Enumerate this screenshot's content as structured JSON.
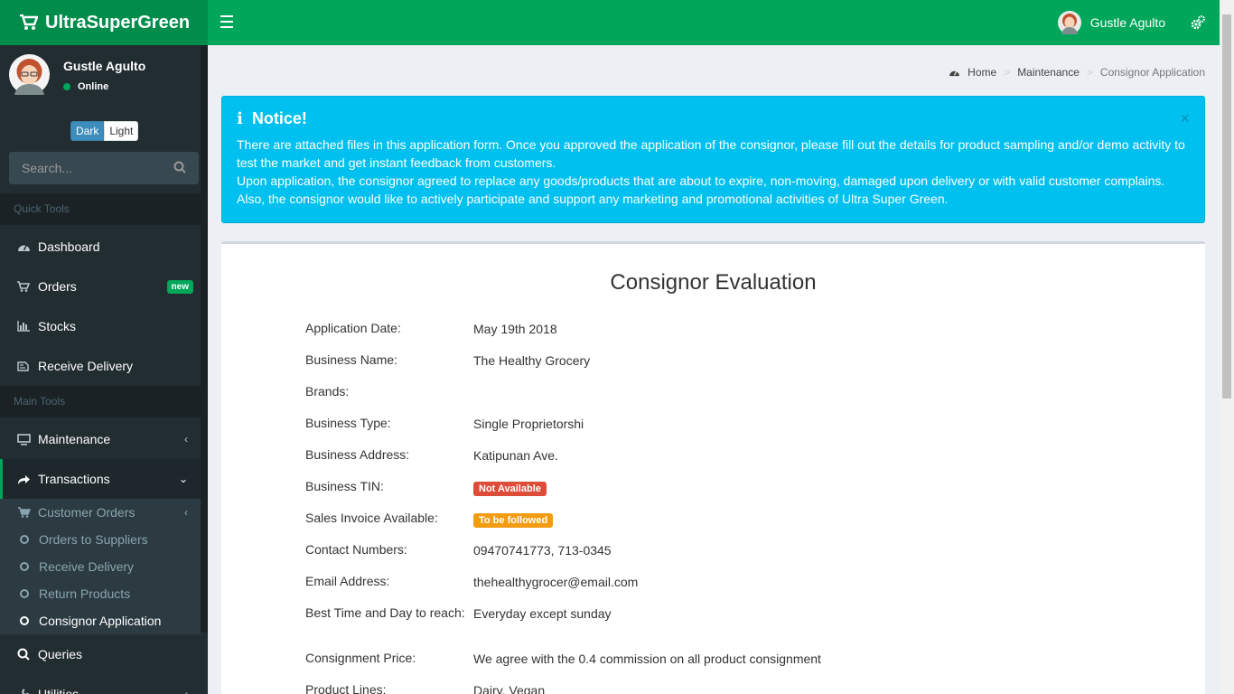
{
  "app": {
    "name": "UltraSuperGreen"
  },
  "header": {
    "user_name": "Gustle Agulto"
  },
  "sidebar": {
    "user": {
      "name": "Gustle Agulto",
      "status": "Online"
    },
    "theme": {
      "dark": "Dark",
      "light": "Light"
    },
    "search_placeholder": "Search...",
    "quick_tools_label": "Quick Tools",
    "main_tools_label": "Main Tools",
    "items": {
      "dashboard": "Dashboard",
      "orders": "Orders",
      "orders_badge": "new",
      "stocks": "Stocks",
      "receive_delivery": "Receive Delivery",
      "maintenance": "Maintenance",
      "transactions": "Transactions",
      "queries": "Queries",
      "utilities": "Utilities"
    },
    "submenu": {
      "customer_orders": "Customer Orders",
      "orders_to_suppliers": "Orders to Suppliers",
      "receive_delivery": "Receive Delivery",
      "return_products": "Return Products",
      "consignor_application": "Consignor Application"
    }
  },
  "breadcrumb": {
    "home": "Home",
    "maintenance": "Maintenance",
    "current": "Consignor Application"
  },
  "notice": {
    "title": "Notice!",
    "line1": "There are attached files in this application form. Once you approved the application of the consignor, please fill out the details for product sampling and/or demo activity to test the market and get instant feedback from customers.",
    "line2": "Upon application, the consignor agreed to replace any goods/products that are about to expire, non-moving, damaged upon delivery or with valid customer complains. Also, the consignor would like to actively participate and support any marketing and promotional activities of Ultra Super Green.",
    "close": "×"
  },
  "evaluation": {
    "title": "Consignor Evaluation",
    "fields": {
      "application_date": {
        "label": "Application Date:",
        "value": "May 19th 2018"
      },
      "business_name": {
        "label": "Business Name:",
        "value": "The Healthy Grocery"
      },
      "brands": {
        "label": "Brands:",
        "value": ""
      },
      "business_type": {
        "label": "Business Type:",
        "value": "Single Proprietorshi"
      },
      "business_address": {
        "label": "Business Address:",
        "value": "Katipunan Ave."
      },
      "business_tin": {
        "label": "Business TIN:",
        "value": "Not Available"
      },
      "sales_invoice": {
        "label": "Sales Invoice Available:",
        "value": "To be followed"
      },
      "contact_numbers": {
        "label": "Contact Numbers:",
        "value": "09470741773, 713-0345"
      },
      "email": {
        "label": "Email Address:",
        "value": "thehealthygrocer@email.com"
      },
      "best_time": {
        "label": "Best Time and Day to reach:",
        "value": "Everyday except sunday"
      },
      "consignment_price": {
        "label": "Consignment Price:",
        "value": "We agree with the 0.4 commission on all product consignment"
      },
      "product_lines": {
        "label": "Product Lines:",
        "value": "Dairy, Vegan"
      }
    }
  },
  "colors": {
    "brand_green": "#00a65a",
    "brand_green_dark": "#008d4c",
    "sidebar_bg": "#222d32",
    "notice_blue": "#00c0ef",
    "badge_red": "#dd4b39",
    "badge_orange": "#f39c12"
  }
}
